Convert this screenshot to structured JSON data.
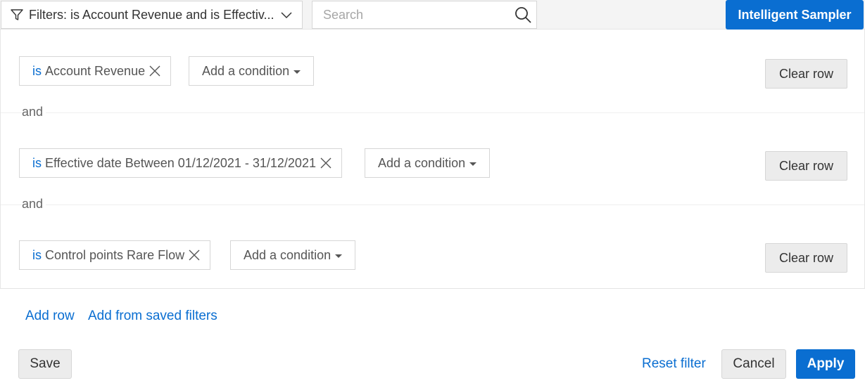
{
  "topbar": {
    "filter_summary": "Filters: is Account Revenue and is Effectiv...",
    "search_placeholder": "Search",
    "sampler_label": "Intelligent Sampler"
  },
  "rows": [
    {
      "is": "is",
      "condition": "Account Revenue",
      "add_condition": "Add a condition",
      "clear": "Clear row"
    },
    {
      "is": "is",
      "condition": "Effective date Between 01/12/2021 - 31/12/2021",
      "add_condition": "Add a condition",
      "clear": "Clear row"
    },
    {
      "is": "is",
      "condition": "Control points Rare Flow",
      "add_condition": "Add a condition",
      "clear": "Clear row"
    }
  ],
  "connector": "and",
  "links": {
    "add_row": "Add row",
    "add_saved": "Add from saved filters"
  },
  "footer": {
    "save": "Save",
    "reset": "Reset filter",
    "cancel": "Cancel",
    "apply": "Apply"
  },
  "colors": {
    "accent": "#0a6ed1",
    "button_grey": "#ececec"
  },
  "icons": {
    "filter": "funnel-icon",
    "dropdown": "chevron-down-icon",
    "search": "search-icon",
    "remove": "close-icon",
    "caret": "caret-down-icon"
  }
}
